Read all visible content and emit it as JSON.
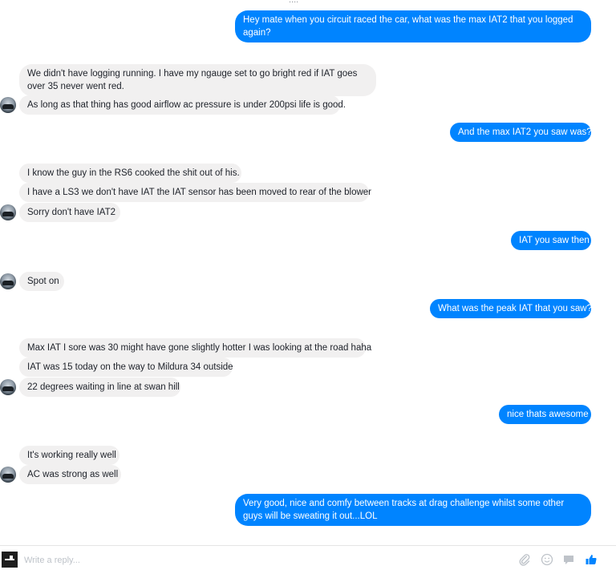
{
  "conversation": {
    "top_cut_text": "....",
    "messages": [
      {
        "side": "out",
        "text": "Hey mate when you circuit raced the car, what was the max IAT2 that you logged again?"
      },
      {
        "side": "in",
        "text": "We didn't have logging running.  I have my ngauge set to go bright red if IAT goes over 35 never went red."
      },
      {
        "side": "in",
        "text": "As long as that thing has good airflow ac pressure is under 200psi life is good."
      },
      {
        "side": "out",
        "text": "And the max IAT2 you saw was?"
      },
      {
        "side": "in",
        "text": "I know the guy in the RS6 cooked the shit out of his."
      },
      {
        "side": "in",
        "text": "I have a LS3 we don't have IAT  the IAT sensor has been moved to rear of the blower"
      },
      {
        "side": "in",
        "text": "Sorry don't have IAT2"
      },
      {
        "side": "out",
        "text": "IAT you saw then"
      },
      {
        "side": "in",
        "text": "Spot on"
      },
      {
        "side": "out",
        "text": "What was the peak IAT that you saw?"
      },
      {
        "side": "in",
        "text": "Max IAT I sore was 30 might have gone slightly hotter I was looking at the road haha"
      },
      {
        "side": "in",
        "text": "IAT was 15 today on the way to Mildura 34 outside"
      },
      {
        "side": "in",
        "text": "22 degrees waiting in line at swan hill"
      },
      {
        "side": "out",
        "text": "nice thats awesome"
      },
      {
        "side": "in",
        "text": "It's working really well"
      },
      {
        "side": "in",
        "text": "AC was strong as well"
      },
      {
        "side": "out",
        "text": "Very good, nice and comfy between tracks at drag challenge whilst some other guys will be sweating it out...LOL"
      }
    ]
  },
  "composer": {
    "placeholder": "Write a reply...",
    "icons": [
      "paperclip-icon",
      "emoji-icon",
      "sticker-icon",
      "thumbs-up-icon"
    ]
  },
  "colors": {
    "outgoing_bubble": "#0084ff",
    "incoming_bubble": "#f1f0f0",
    "accent": "#0084ff"
  }
}
